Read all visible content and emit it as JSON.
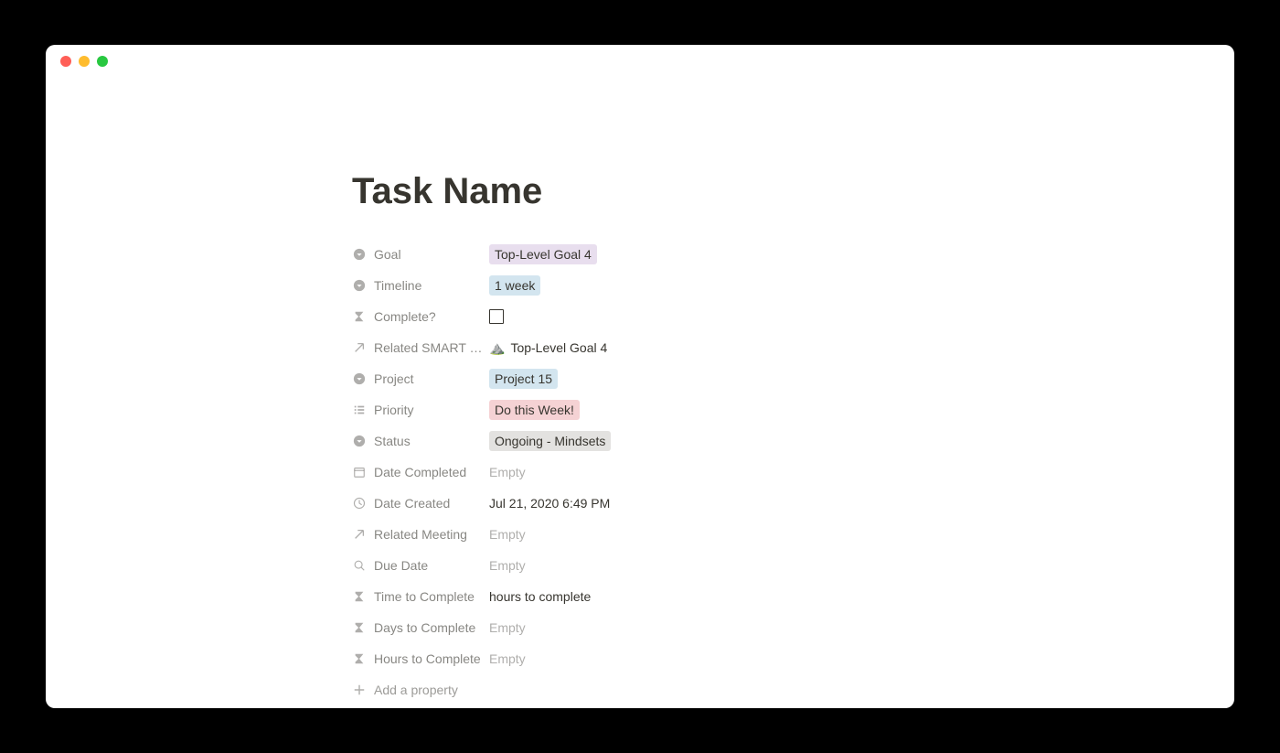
{
  "page": {
    "title": "Task Name"
  },
  "properties": {
    "goal": {
      "label": "Goal",
      "value": "Top-Level Goal 4"
    },
    "timeline": {
      "label": "Timeline",
      "value": "1 week"
    },
    "complete": {
      "label": "Complete?",
      "checked": false
    },
    "related_smart_goal": {
      "label": "Related SMART G...",
      "emoji": "⛰️",
      "value": "Top-Level Goal 4"
    },
    "project": {
      "label": "Project",
      "value": "Project 15"
    },
    "priority": {
      "label": "Priority",
      "value": "Do this Week!"
    },
    "status": {
      "label": "Status",
      "value": "Ongoing - Mindsets"
    },
    "date_completed": {
      "label": "Date Completed",
      "value": "Empty"
    },
    "date_created": {
      "label": "Date Created",
      "value": "Jul 21, 2020 6:49 PM"
    },
    "related_meeting": {
      "label": "Related Meeting",
      "value": "Empty"
    },
    "due_date": {
      "label": "Due Date",
      "value": "Empty"
    },
    "time_to_complete": {
      "label": "Time to Complete",
      "value": " hours to complete"
    },
    "days_to_complete": {
      "label": "Days to Complete",
      "value": "Empty"
    },
    "hours_to_complete": {
      "label": "Hours to Complete",
      "value": "Empty"
    }
  },
  "actions": {
    "add_property": "Add a property"
  }
}
